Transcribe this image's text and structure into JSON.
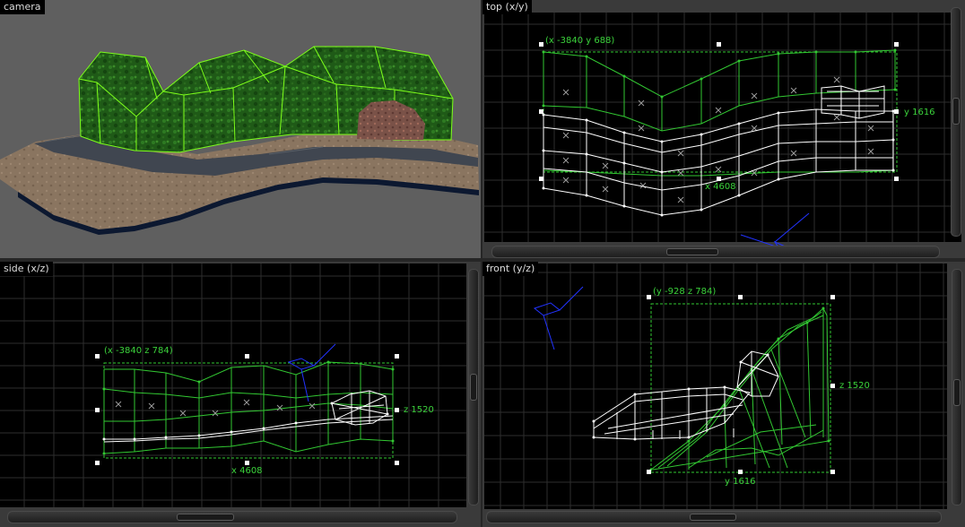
{
  "viewports": {
    "camera": {
      "title": "camera"
    },
    "top": {
      "title": "top (x/y)",
      "origin_label": "(x -3840 y 688)",
      "height_label": "y 1616",
      "width_label": "x 4608"
    },
    "side": {
      "title": "side (x/z)",
      "origin_label": "(x -3840 z 784)",
      "height_label": "z 1520",
      "width_label": "x 4608"
    },
    "front": {
      "title": "front (y/z)",
      "origin_label": "(y -928 z 784)",
      "height_label": "z 1520",
      "width_label": "y 1616"
    }
  },
  "colors": {
    "grid": "#2e2e2e",
    "selection": "#32c832",
    "wire": "#ffffff",
    "camera_marker": "#2233ff",
    "camera_bg": "#5f5f5f"
  },
  "icons": [
    "camera-marker-icon",
    "scroll-thumb"
  ]
}
